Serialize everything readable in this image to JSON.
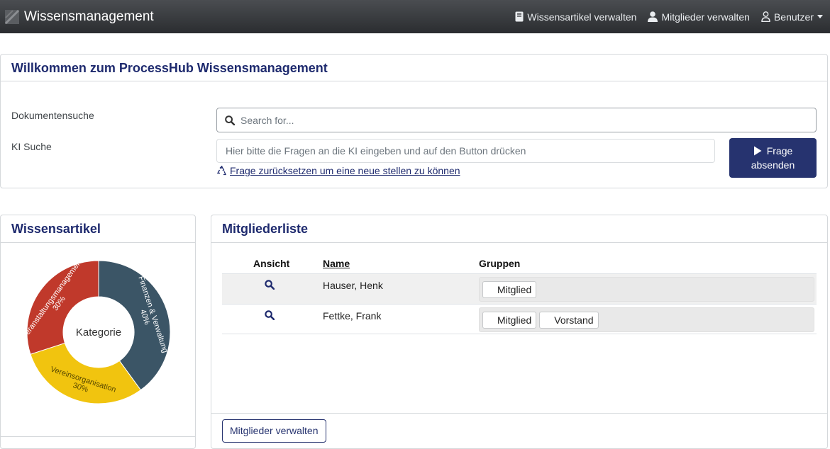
{
  "navbar": {
    "title": "Wissensmanagement",
    "items": [
      {
        "label": "Wissensartikel verwalten",
        "icon": "book-icon"
      },
      {
        "label": "Mitglieder verwalten",
        "icon": "user-icon"
      },
      {
        "label": "Benutzer",
        "icon": "user-outline-icon"
      }
    ]
  },
  "welcome": {
    "title": "Willkommen zum ProcessHub Wissensmanagement",
    "doc_search_label": "Dokumentensuche",
    "doc_search_placeholder": "Search for...",
    "ki_label": "KI Suche",
    "ki_placeholder": "Hier bitte die Fragen an die KI eingeben und auf den Button drücken",
    "reset_link": " Frage zurücksetzen um eine neue stellen zu können",
    "send_line1": "Frage",
    "send_line2": "absenden"
  },
  "articles": {
    "title": "Wissensartikel",
    "center_label": "Kategorie",
    "chart_data": {
      "type": "pie",
      "title": "",
      "slices": [
        {
          "label": "Finanzen & Verwaltung",
          "percent_label": "40%",
          "value": 40,
          "color": "#3b5566"
        },
        {
          "label": "Vereinsorganisation",
          "percent_label": "30%",
          "value": 30,
          "color": "#f1c40f"
        },
        {
          "label": "Veranstaltungsmanagement",
          "percent_label": "30%",
          "value": 30,
          "color": "#c0392b"
        }
      ]
    }
  },
  "members": {
    "title": "Mitgliederliste",
    "columns": [
      "Ansicht",
      "Name",
      "Gruppen"
    ],
    "rows": [
      {
        "name": "Hauser, Henk",
        "groups": [
          "Mitglied"
        ]
      },
      {
        "name": "Fettke, Frank",
        "groups": [
          "Mitglied",
          "Vorstand"
        ]
      }
    ],
    "manage_button": "Mitglieder verwalten"
  },
  "colors": {
    "accent": "#26336f",
    "title": "#1e2a6e"
  }
}
